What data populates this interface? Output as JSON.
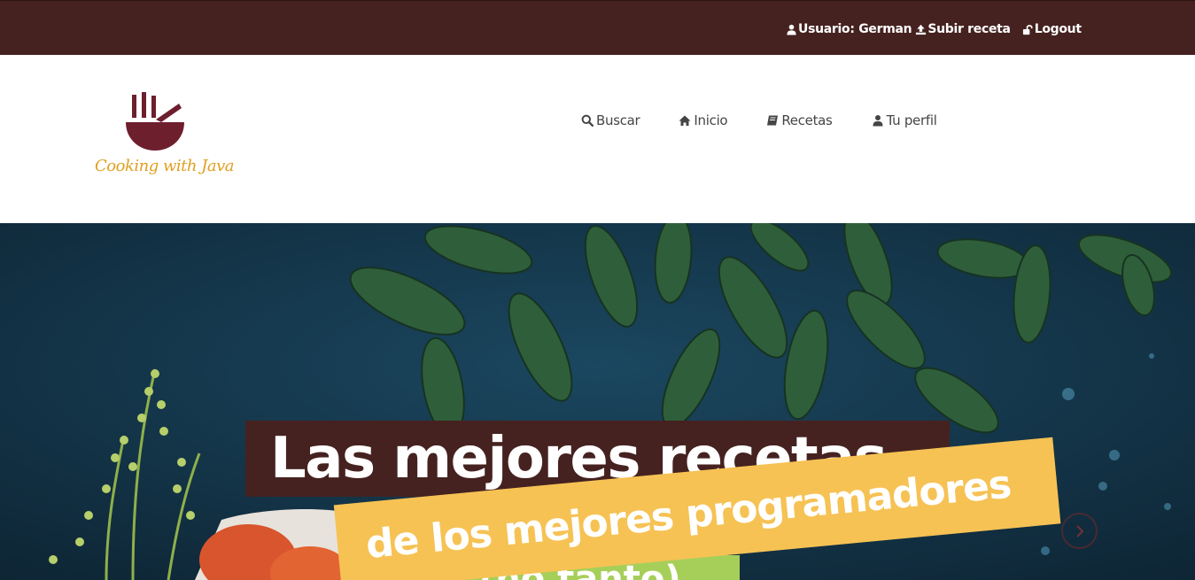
{
  "topbar": {
    "user_label": "Usuario: German",
    "upload_label": "Subir receta",
    "logout_label": "Logout"
  },
  "logo": {
    "text": "Cooking with Java",
    "icon": "bowl-with-chopsticks-icon"
  },
  "nav": {
    "items": [
      {
        "label": "Buscar",
        "icon": "search-icon"
      },
      {
        "label": "Inicio",
        "icon": "home-icon"
      },
      {
        "label": "Recetas",
        "icon": "book-icon"
      },
      {
        "label": "Tu perfil",
        "icon": "user-icon"
      }
    ]
  },
  "hero": {
    "title_line1": "Las mejores recetas",
    "title_line2": "de los mejores programadores",
    "title_line3": "(no tanto)",
    "next_icon": "chevron-right-icon"
  },
  "colors": {
    "brand_dark": "#452220",
    "accent_yellow": "#f6c254",
    "accent_green": "#a6cf5a",
    "logo_text": "#e0a021"
  }
}
